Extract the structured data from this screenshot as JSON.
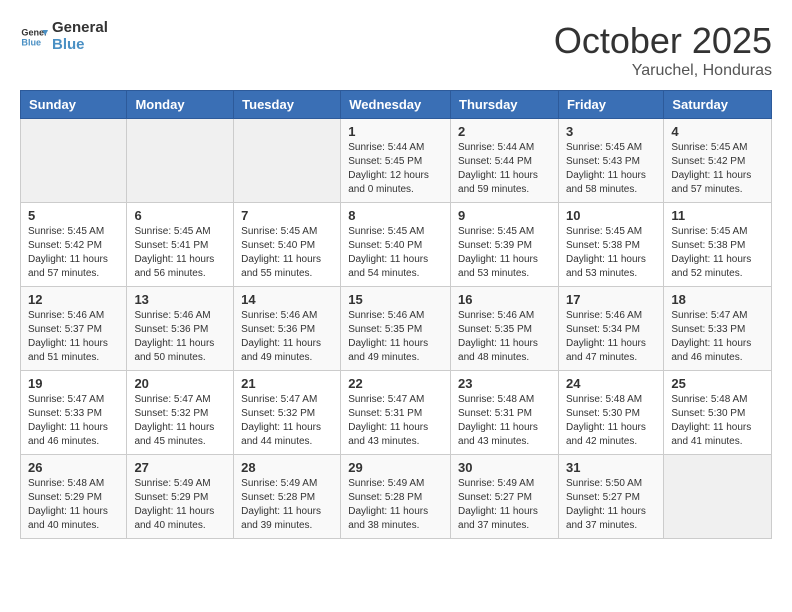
{
  "logo": {
    "line1": "General",
    "line2": "Blue"
  },
  "title": "October 2025",
  "subtitle": "Yaruchel, Honduras",
  "headers": [
    "Sunday",
    "Monday",
    "Tuesday",
    "Wednesday",
    "Thursday",
    "Friday",
    "Saturday"
  ],
  "weeks": [
    [
      {
        "day": "",
        "info": ""
      },
      {
        "day": "",
        "info": ""
      },
      {
        "day": "",
        "info": ""
      },
      {
        "day": "1",
        "info": "Sunrise: 5:44 AM\nSunset: 5:45 PM\nDaylight: 12 hours\nand 0 minutes."
      },
      {
        "day": "2",
        "info": "Sunrise: 5:44 AM\nSunset: 5:44 PM\nDaylight: 11 hours\nand 59 minutes."
      },
      {
        "day": "3",
        "info": "Sunrise: 5:45 AM\nSunset: 5:43 PM\nDaylight: 11 hours\nand 58 minutes."
      },
      {
        "day": "4",
        "info": "Sunrise: 5:45 AM\nSunset: 5:42 PM\nDaylight: 11 hours\nand 57 minutes."
      }
    ],
    [
      {
        "day": "5",
        "info": "Sunrise: 5:45 AM\nSunset: 5:42 PM\nDaylight: 11 hours\nand 57 minutes."
      },
      {
        "day": "6",
        "info": "Sunrise: 5:45 AM\nSunset: 5:41 PM\nDaylight: 11 hours\nand 56 minutes."
      },
      {
        "day": "7",
        "info": "Sunrise: 5:45 AM\nSunset: 5:40 PM\nDaylight: 11 hours\nand 55 minutes."
      },
      {
        "day": "8",
        "info": "Sunrise: 5:45 AM\nSunset: 5:40 PM\nDaylight: 11 hours\nand 54 minutes."
      },
      {
        "day": "9",
        "info": "Sunrise: 5:45 AM\nSunset: 5:39 PM\nDaylight: 11 hours\nand 53 minutes."
      },
      {
        "day": "10",
        "info": "Sunrise: 5:45 AM\nSunset: 5:38 PM\nDaylight: 11 hours\nand 53 minutes."
      },
      {
        "day": "11",
        "info": "Sunrise: 5:45 AM\nSunset: 5:38 PM\nDaylight: 11 hours\nand 52 minutes."
      }
    ],
    [
      {
        "day": "12",
        "info": "Sunrise: 5:46 AM\nSunset: 5:37 PM\nDaylight: 11 hours\nand 51 minutes."
      },
      {
        "day": "13",
        "info": "Sunrise: 5:46 AM\nSunset: 5:36 PM\nDaylight: 11 hours\nand 50 minutes."
      },
      {
        "day": "14",
        "info": "Sunrise: 5:46 AM\nSunset: 5:36 PM\nDaylight: 11 hours\nand 49 minutes."
      },
      {
        "day": "15",
        "info": "Sunrise: 5:46 AM\nSunset: 5:35 PM\nDaylight: 11 hours\nand 49 minutes."
      },
      {
        "day": "16",
        "info": "Sunrise: 5:46 AM\nSunset: 5:35 PM\nDaylight: 11 hours\nand 48 minutes."
      },
      {
        "day": "17",
        "info": "Sunrise: 5:46 AM\nSunset: 5:34 PM\nDaylight: 11 hours\nand 47 minutes."
      },
      {
        "day": "18",
        "info": "Sunrise: 5:47 AM\nSunset: 5:33 PM\nDaylight: 11 hours\nand 46 minutes."
      }
    ],
    [
      {
        "day": "19",
        "info": "Sunrise: 5:47 AM\nSunset: 5:33 PM\nDaylight: 11 hours\nand 46 minutes."
      },
      {
        "day": "20",
        "info": "Sunrise: 5:47 AM\nSunset: 5:32 PM\nDaylight: 11 hours\nand 45 minutes."
      },
      {
        "day": "21",
        "info": "Sunrise: 5:47 AM\nSunset: 5:32 PM\nDaylight: 11 hours\nand 44 minutes."
      },
      {
        "day": "22",
        "info": "Sunrise: 5:47 AM\nSunset: 5:31 PM\nDaylight: 11 hours\nand 43 minutes."
      },
      {
        "day": "23",
        "info": "Sunrise: 5:48 AM\nSunset: 5:31 PM\nDaylight: 11 hours\nand 43 minutes."
      },
      {
        "day": "24",
        "info": "Sunrise: 5:48 AM\nSunset: 5:30 PM\nDaylight: 11 hours\nand 42 minutes."
      },
      {
        "day": "25",
        "info": "Sunrise: 5:48 AM\nSunset: 5:30 PM\nDaylight: 11 hours\nand 41 minutes."
      }
    ],
    [
      {
        "day": "26",
        "info": "Sunrise: 5:48 AM\nSunset: 5:29 PM\nDaylight: 11 hours\nand 40 minutes."
      },
      {
        "day": "27",
        "info": "Sunrise: 5:49 AM\nSunset: 5:29 PM\nDaylight: 11 hours\nand 40 minutes."
      },
      {
        "day": "28",
        "info": "Sunrise: 5:49 AM\nSunset: 5:28 PM\nDaylight: 11 hours\nand 39 minutes."
      },
      {
        "day": "29",
        "info": "Sunrise: 5:49 AM\nSunset: 5:28 PM\nDaylight: 11 hours\nand 38 minutes."
      },
      {
        "day": "30",
        "info": "Sunrise: 5:49 AM\nSunset: 5:27 PM\nDaylight: 11 hours\nand 37 minutes."
      },
      {
        "day": "31",
        "info": "Sunrise: 5:50 AM\nSunset: 5:27 PM\nDaylight: 11 hours\nand 37 minutes."
      },
      {
        "day": "",
        "info": ""
      }
    ]
  ]
}
